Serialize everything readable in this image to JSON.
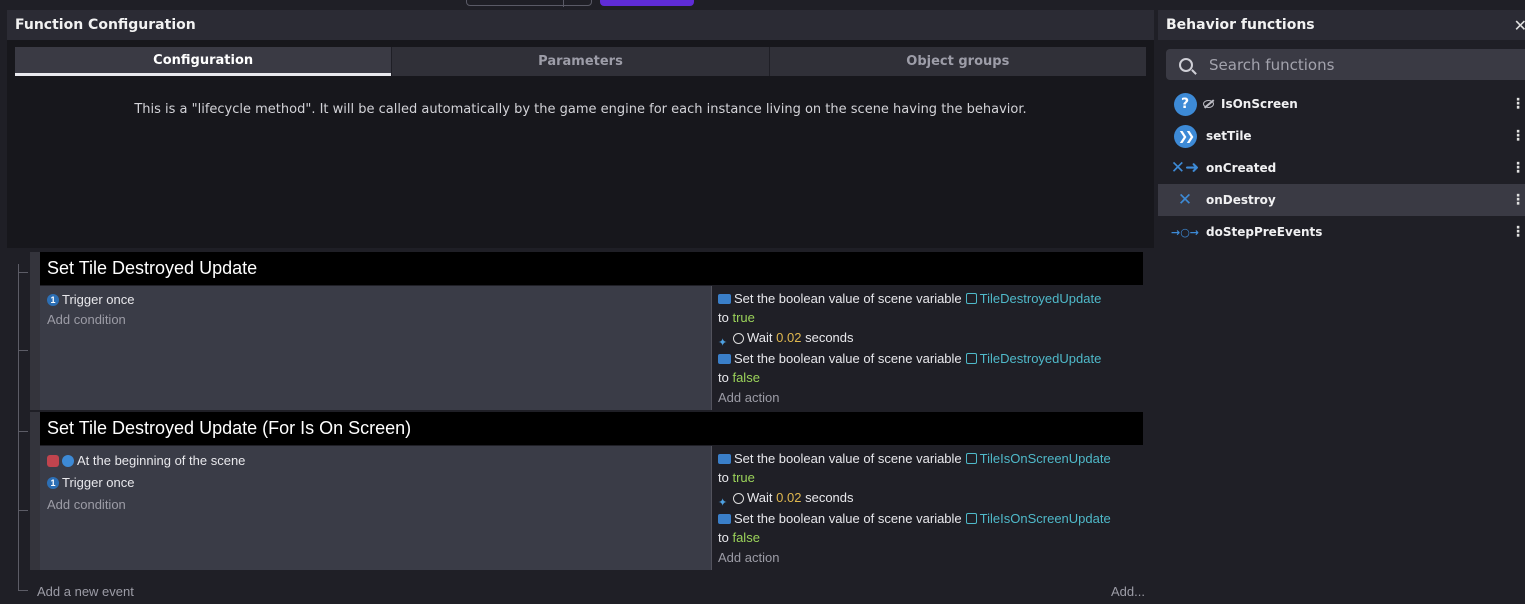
{
  "function_config": {
    "title": "Function Configuration",
    "tabs": [
      {
        "label": "Configuration",
        "active": true
      },
      {
        "label": "Parameters",
        "active": false
      },
      {
        "label": "Object groups",
        "active": false
      }
    ],
    "lifecycle_note": "This is a \"lifecycle method\". It will be called automatically by the game engine for each instance living on the scene having the behavior."
  },
  "events": [
    {
      "title": "Set Tile Destroyed Update",
      "conditions": [
        {
          "icon": "trigger-once-icon",
          "text": "Trigger once"
        }
      ],
      "add_condition": "Add condition",
      "actions": [
        {
          "type": "set-bool",
          "text": "Set the boolean value of scene variable",
          "variable": "TileDestroyedUpdate",
          "to": "to",
          "value": "true"
        },
        {
          "type": "wait",
          "text1": "Wait",
          "value": "0.02",
          "text2": "seconds"
        },
        {
          "type": "set-bool",
          "text": "Set the boolean value of scene variable",
          "variable": "TileDestroyedUpdate",
          "to": "to",
          "value": "false"
        }
      ],
      "add_action": "Add action"
    },
    {
      "title": "Set Tile Destroyed Update (For Is On Screen)",
      "conditions": [
        {
          "icon": "scene-start-icon",
          "text": "At the beginning of the scene"
        },
        {
          "icon": "trigger-once-icon",
          "text": "Trigger once"
        }
      ],
      "add_condition": "Add condition",
      "actions": [
        {
          "type": "set-bool",
          "text": "Set the boolean value of scene variable",
          "variable": "TileIsOnScreenUpdate",
          "to": "to",
          "value": "true"
        },
        {
          "type": "wait",
          "text1": "Wait",
          "value": "0.02",
          "text2": "seconds"
        },
        {
          "type": "set-bool",
          "text": "Set the boolean value of scene variable",
          "variable": "TileIsOnScreenUpdate",
          "to": "to",
          "value": "false"
        }
      ],
      "add_action": "Add action"
    }
  ],
  "footer": {
    "add_event": "Add a new event",
    "add_more": "Add..."
  },
  "behavior_functions": {
    "title": "Behavior functions",
    "search_placeholder": "Search functions",
    "items": [
      {
        "label": "IsOnScreen",
        "icon": "question-icon",
        "hidden": true,
        "selected": false
      },
      {
        "label": "setTile",
        "icon": "arrows-icon",
        "hidden": false,
        "selected": false
      },
      {
        "label": "onCreated",
        "icon": "created-icon",
        "hidden": false,
        "selected": false
      },
      {
        "label": "onDestroy",
        "icon": "destroy-icon",
        "hidden": false,
        "selected": true
      },
      {
        "label": "doStepPreEvents",
        "icon": "step-icon",
        "hidden": false,
        "selected": false
      }
    ]
  },
  "colors": {
    "accent_purple": "#5f2cd8",
    "variable_color": "#4fb9c9",
    "bool_color": "#9bd35a",
    "number_color": "#e0b84f"
  }
}
